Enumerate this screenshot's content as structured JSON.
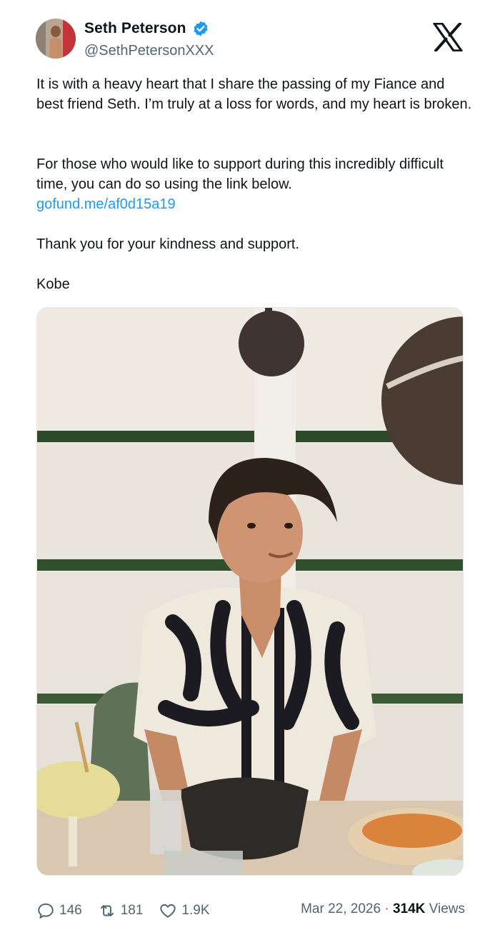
{
  "author": {
    "name": "Seth Peterson",
    "handle": "@SethPetersonXXX",
    "verified": true
  },
  "platform_logo": "x-logo-icon",
  "post": {
    "paragraph1": "It is with a heavy heart that I share the passing of my Fiance and best friend Seth. I’m truly at a loss for words, and my heart is broken.",
    "paragraph2": "For those who would like to support during this incredibly difficult time, you can do so using the link below.",
    "link": "gofund.me/af0d15a19",
    "paragraph3": "Thank you for your kindness and support.",
    "signature": "Kobe"
  },
  "media": {
    "type": "photo",
    "icon": "photo-of-young-man-at-restaurant-table"
  },
  "metrics": {
    "replies": "146",
    "reposts": "181",
    "likes": "1.9K",
    "date": "Mar 22, 2026",
    "separator": "·",
    "views_count": "314K",
    "views_label": "Views"
  },
  "colors": {
    "link": "#1d9bf0",
    "verified": "#1d9bf0",
    "secondary_text": "#536471"
  }
}
